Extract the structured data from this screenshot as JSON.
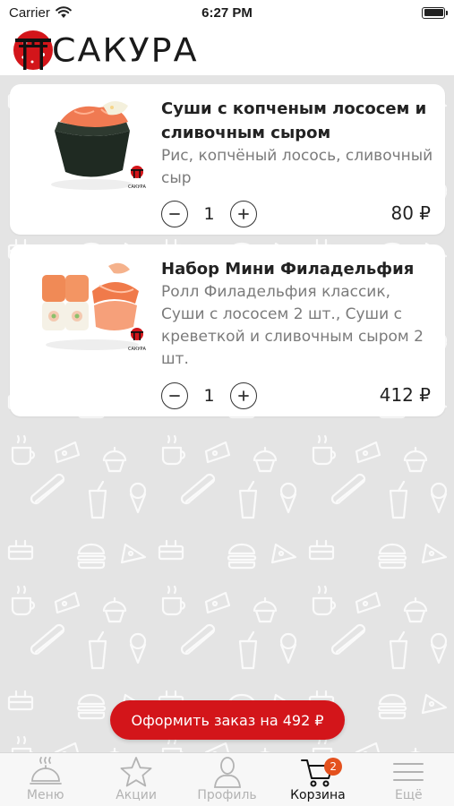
{
  "status_bar": {
    "carrier": "Carrier",
    "time": "6:27 PM"
  },
  "header": {
    "logo_text": "САКУРА"
  },
  "cart": {
    "items": [
      {
        "title": "Суши с копченым лососем и сливочным сыром",
        "description": "Рис, копчёный лосось, сливочный сыр",
        "quantity": "1",
        "price": "80 ₽",
        "brand_mark": "САКУРА"
      },
      {
        "title": "Набор Мини Филадельфия",
        "description": "Ролл Филадельфия классик, Суши с лососем 2 шт., Суши с креветкой и сливочным сыром 2 шт.",
        "quantity": "1",
        "price": "412 ₽",
        "brand_mark": "САКУРА"
      }
    ]
  },
  "checkout_button": "Оформить заказ на 492 ₽",
  "tabs": [
    {
      "label": "Меню",
      "icon": "cloche-icon"
    },
    {
      "label": "Акции",
      "icon": "star-icon"
    },
    {
      "label": "Профиль",
      "icon": "person-icon"
    },
    {
      "label": "Корзина",
      "icon": "cart-icon",
      "badge": "2"
    },
    {
      "label": "Ещё",
      "icon": "menu-icon"
    }
  ],
  "colors": {
    "accent": "#d3151a",
    "badge": "#e4511e",
    "background": "#e4e4e4"
  }
}
